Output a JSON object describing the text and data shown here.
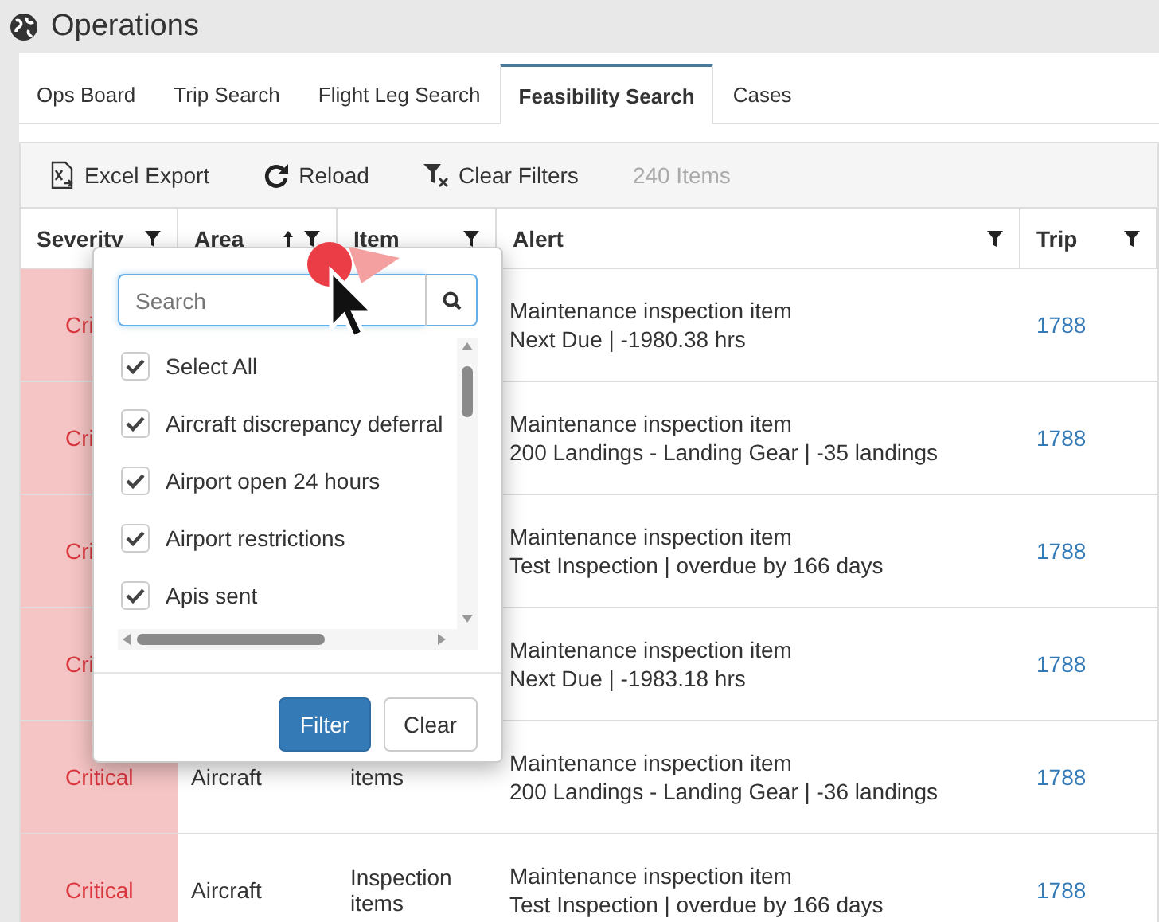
{
  "app": {
    "title": "Operations"
  },
  "tabs": [
    {
      "label": "Ops Board",
      "selected": false
    },
    {
      "label": "Trip Search",
      "selected": false
    },
    {
      "label": "Flight Leg Search",
      "selected": false
    },
    {
      "label": "Feasibility Search",
      "selected": true
    },
    {
      "label": "Cases",
      "selected": false
    }
  ],
  "toolbar": {
    "buttons": [
      {
        "label": "Excel Export",
        "kind": "excel"
      },
      {
        "label": "Reload",
        "kind": "reload"
      },
      {
        "label": "Clear Filters",
        "kind": "clear"
      }
    ],
    "count": "240 Items"
  },
  "table": {
    "columns": [
      {
        "label": "Severity",
        "sorted": false
      },
      {
        "label": "Area",
        "sorted": true
      },
      {
        "label": "Item",
        "sorted": false
      },
      {
        "label": "Alert",
        "sorted": false
      },
      {
        "label": "Trip",
        "sorted": false
      }
    ],
    "rows": [
      {
        "severity": "Cri",
        "alert": [
          "Maintenance inspection item",
          "Next Due | -1980.38 hrs"
        ],
        "trip": "1788"
      },
      {
        "severity": "Cri",
        "alert": [
          "Maintenance inspection item",
          "200 Landings - Landing Gear | -35 landings"
        ],
        "trip": "1788"
      },
      {
        "severity": "Cri",
        "alert": [
          "Maintenance inspection item",
          "Test Inspection | overdue by 166 days"
        ],
        "trip": "1788"
      },
      {
        "severity": "Cri",
        "alert": [
          "Maintenance inspection item",
          "Next Due | -1983.18 hrs"
        ],
        "trip": "1788"
      },
      {
        "severity": "Critical",
        "area": "Aircraft",
        "item": "items",
        "alert": [
          "Maintenance inspection item",
          "200 Landings - Landing Gear | -36 landings"
        ],
        "trip": "1788"
      },
      {
        "severity": "Critical",
        "area": "Aircraft",
        "item": "Inspection items",
        "alert": [
          "Maintenance inspection item",
          "Test Inspection | overdue by 166 days"
        ],
        "trip": "1788"
      }
    ]
  },
  "filter_popup": {
    "search": {
      "placeholder": "Search"
    },
    "options": [
      {
        "label": "Select All",
        "checked": true
      },
      {
        "label": "Aircraft discrepancy deferral",
        "checked": true
      },
      {
        "label": "Airport open 24 hours",
        "checked": true
      },
      {
        "label": "Airport restrictions",
        "checked": true
      },
      {
        "label": "Apis sent",
        "checked": true
      }
    ],
    "buttons": [
      {
        "label": "Filter",
        "kind": "primary"
      },
      {
        "label": "Clear",
        "kind": "default"
      }
    ]
  }
}
